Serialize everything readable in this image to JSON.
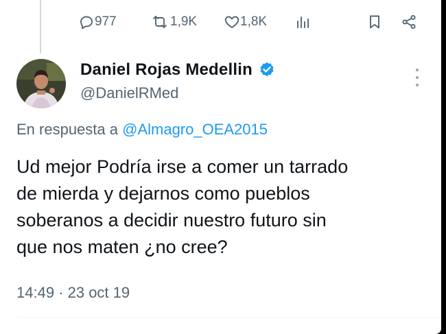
{
  "metrics": {
    "replies": "977",
    "retweets": "1,9K",
    "likes": "1,8K"
  },
  "author": {
    "name": "Daniel Rojas Medellin",
    "handle": "@DanielRMed",
    "verified": true
  },
  "reply_to": {
    "prefix": "En respuesta a ",
    "mention": "@Almagro_OEA2015"
  },
  "tweet": {
    "lines": [
      "Ud mejor Podría irse a comer un tarrado",
      "de mierda y dejarnos como pueblos",
      "soberanos a decidir nuestro futuro sin",
      "que nos maten ¿no cree?"
    ],
    "timestamp": "14:49 · 23 oct 19"
  },
  "icons": {
    "reply": "reply-icon",
    "retweet": "retweet-icon",
    "like": "heart-icon",
    "views": "views-icon",
    "bookmark": "bookmark-icon",
    "share": "share-icon",
    "verified": "verified-badge-icon",
    "more": "more-options-icon"
  },
  "colors": {
    "accent": "#1d9bf0",
    "text": "#0f1419",
    "secondary": "#536471"
  }
}
